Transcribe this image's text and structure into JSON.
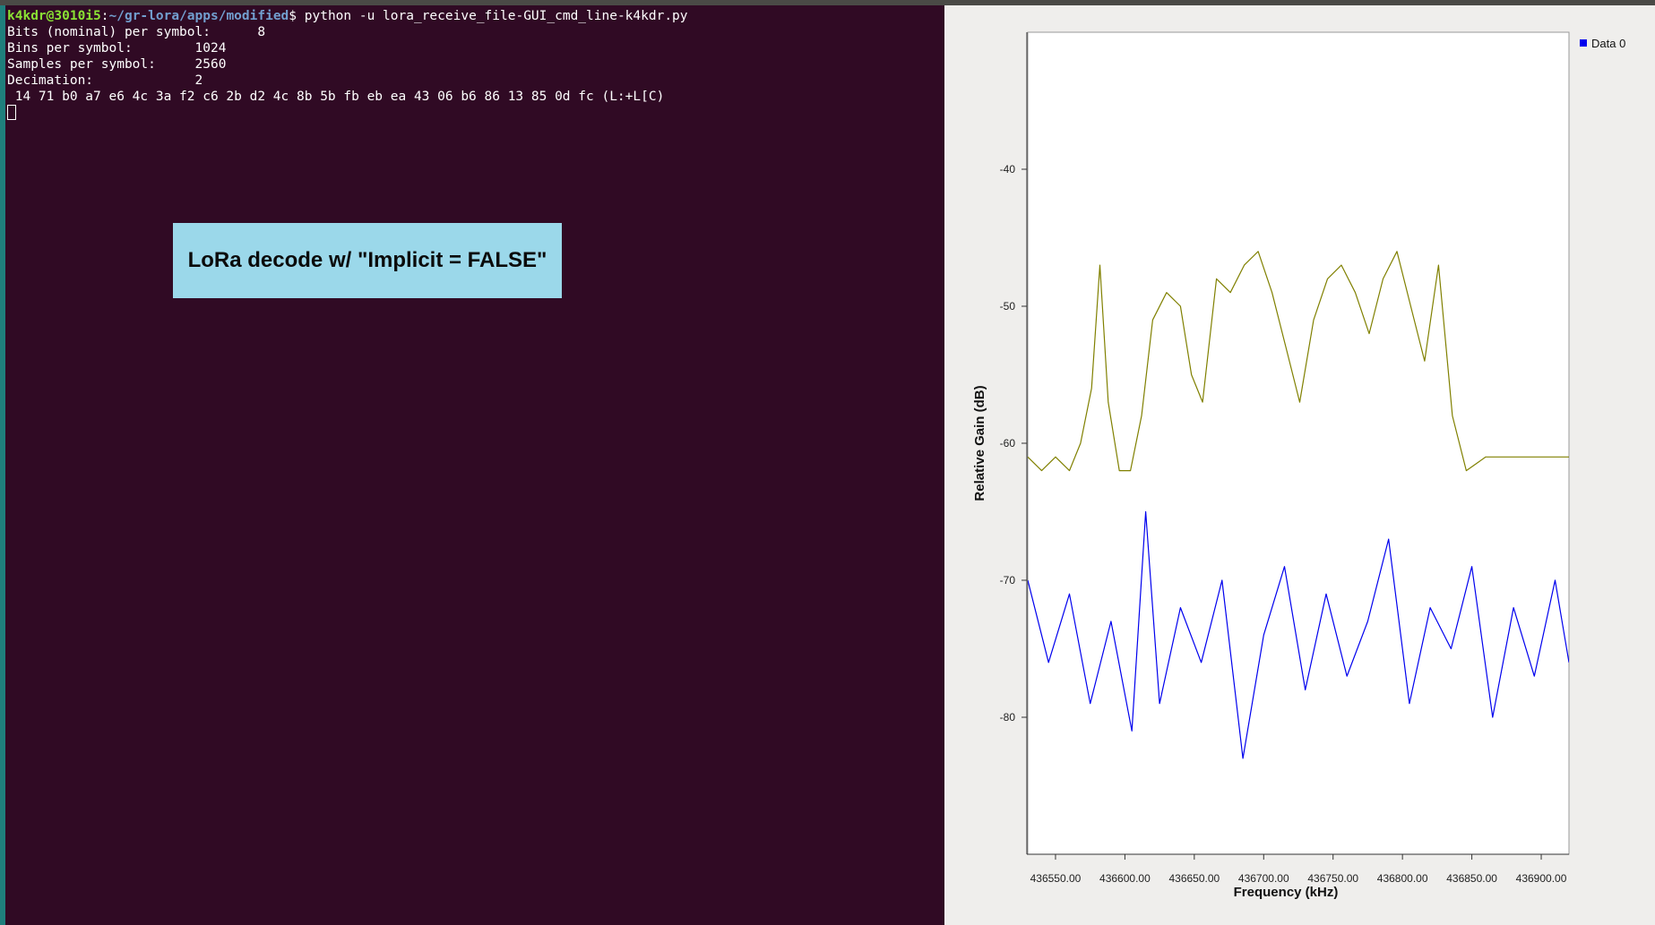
{
  "terminal": {
    "prompt_user": "k4kdr@3010i5",
    "prompt_path": "~/gr-lora/apps/modified",
    "prompt_symbol": "$",
    "command": " python -u lora_receive_file-GUI_cmd_line-k4kdr.py",
    "output_lines": [
      "Bits (nominal) per symbol:      8",
      "Bins per symbol:        1024",
      "Samples per symbol:     2560",
      "Decimation:             2",
      " 14 71 b0 a7 e6 4c 3a f2 c6 2b d2 4c 8b 5b fb eb ea 43 06 b6 86 13 85 0d fc (L:+L[C)"
    ]
  },
  "overlay": {
    "label": "LoRa decode w/ \"Implicit = FALSE\""
  },
  "chart_data": {
    "type": "line",
    "xlabel": "Frequency (kHz)",
    "ylabel": "Relative Gain (dB)",
    "xlim": [
      436530,
      436920
    ],
    "ylim": [
      -90,
      -30
    ],
    "x_ticks": [
      "436550.00",
      "436600.00",
      "436650.00",
      "436700.00",
      "436750.00",
      "436800.00",
      "436850.00",
      "436900.00"
    ],
    "y_ticks": [
      "-40",
      "-50",
      "-60",
      "-70",
      "-80"
    ],
    "legend": "top-right",
    "series": [
      {
        "name": "Data 0",
        "color": "#0000ee",
        "x": [
          436530,
          436545,
          436560,
          436575,
          436590,
          436605,
          436615,
          436625,
          436640,
          436655,
          436670,
          436685,
          436700,
          436715,
          436730,
          436745,
          436760,
          436775,
          436790,
          436805,
          436820,
          436835,
          436850,
          436865,
          436880,
          436895,
          436910,
          436920
        ],
        "values": [
          -70,
          -76,
          -71,
          -79,
          -73,
          -81,
          -65,
          -79,
          -72,
          -76,
          -70,
          -83,
          -74,
          -69,
          -78,
          -71,
          -77,
          -73,
          -67,
          -79,
          -72,
          -75,
          -69,
          -80,
          -72,
          -77,
          -70,
          -76
        ]
      },
      {
        "color": "#808000",
        "x": [
          436530,
          436540,
          436550,
          436560,
          436568,
          436576,
          436582,
          436588,
          436596,
          436604,
          436612,
          436620,
          436630,
          436640,
          436648,
          436656,
          436666,
          436676,
          436686,
          436696,
          436706,
          436716,
          436726,
          436736,
          436746,
          436756,
          436766,
          436776,
          436786,
          436796,
          436806,
          436816,
          436826,
          436836,
          436846,
          436860,
          436875,
          436890,
          436905,
          436920
        ],
        "values": [
          -61,
          -62,
          -61,
          -62,
          -60,
          -56,
          -47,
          -57,
          -62,
          -62,
          -58,
          -51,
          -49,
          -50,
          -55,
          -57,
          -48,
          -49,
          -47,
          -46,
          -49,
          -53,
          -57,
          -51,
          -48,
          -47,
          -49,
          -52,
          -48,
          -46,
          -50,
          -54,
          -47,
          -58,
          -62,
          -61,
          -61,
          -61,
          -61,
          -61
        ]
      }
    ]
  }
}
